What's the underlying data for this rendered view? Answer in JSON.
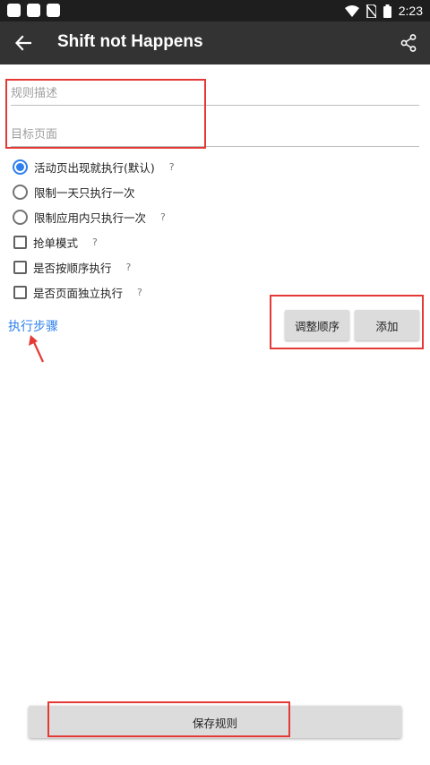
{
  "status_bar": {
    "time": "2:23",
    "icons": [
      "notification-icon",
      "notification-icon",
      "notification-icon",
      "wifi-icon",
      "no-sim-icon",
      "battery-icon"
    ]
  },
  "app_bar": {
    "title": "Shift not Happens",
    "back_icon": "arrow-back-icon",
    "share_icon": "share-icon"
  },
  "form": {
    "rule_description_placeholder": "规则描述",
    "target_page_placeholder": "目标页面",
    "options": [
      {
        "type": "radio",
        "label": "活动页出现就执行(默认)",
        "checked": true,
        "help": "?"
      },
      {
        "type": "radio",
        "label": "限制一天只执行一次",
        "checked": false,
        "help": ""
      },
      {
        "type": "radio",
        "label": "限制应用内只执行一次",
        "checked": false,
        "help": "?"
      },
      {
        "type": "checkbox",
        "label": "抢单模式",
        "checked": false,
        "help": "?"
      },
      {
        "type": "checkbox",
        "label": "是否按顺序执行",
        "checked": false,
        "help": "?"
      },
      {
        "type": "checkbox",
        "label": "是否页面独立执行",
        "checked": false,
        "help": "?"
      }
    ],
    "steps_link": "执行步骤",
    "reorder_button": "调整顺序",
    "add_button": "添加",
    "save_button": "保存规则"
  },
  "colors": {
    "status_bar": "#1e1e1e",
    "app_bar": "#333333",
    "accent": "#2f80ed",
    "highlight": "#e53935",
    "button_bg": "#dcdcdc"
  }
}
